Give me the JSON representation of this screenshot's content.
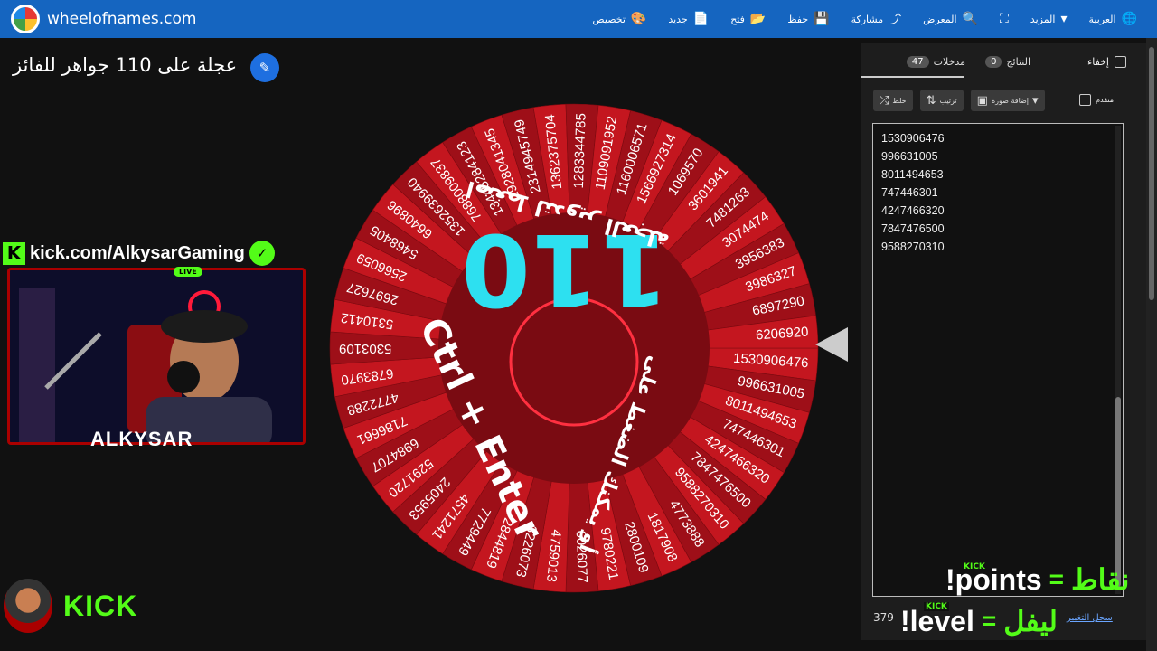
{
  "app": {
    "site": "wheelofnames.com",
    "menu": [
      {
        "name": "menu-language",
        "icon": "globe-icon",
        "glyph": "🌐",
        "label": "العربية"
      },
      {
        "name": "menu-more",
        "icon": "caret-down-icon",
        "glyph": "▾",
        "label": "المزيد"
      },
      {
        "name": "menu-fullscreen",
        "icon": "fullscreen-icon",
        "glyph": "⛶",
        "label": ""
      },
      {
        "name": "menu-gallery",
        "icon": "search-icon",
        "glyph": "🔍",
        "label": "المعرض"
      },
      {
        "name": "menu-share",
        "icon": "share-icon",
        "glyph": "⤴",
        "label": "مشاركة"
      },
      {
        "name": "menu-save",
        "icon": "save-icon",
        "glyph": "💾",
        "label": "حفظ"
      },
      {
        "name": "menu-open",
        "icon": "folder-icon",
        "glyph": "📂",
        "label": "فتح"
      },
      {
        "name": "menu-new",
        "icon": "file-icon",
        "glyph": "📄",
        "label": "جديد"
      },
      {
        "name": "menu-customize",
        "icon": "palette-icon",
        "glyph": "🎨",
        "label": "تخصيص"
      }
    ],
    "colors": {
      "topbar": "#1565c0",
      "kick_green": "#53fc18",
      "wheel_red": "#b3121c"
    }
  },
  "wheel": {
    "title": "عجلة على 110 جواهر للفائز",
    "center_text": "110",
    "hint_top": "اضغط لتدوير العجلة",
    "hint_bottom": "أو يمكنك الضغط على",
    "hint_keys": "Ctrl + Enter",
    "segments": [
      "1530906476",
      "996631005",
      "8011494653",
      "747446301",
      "4247466320",
      "7847476500",
      "9588270310",
      "4773888",
      "1817908",
      "2800109",
      "9780221",
      "6026077",
      "4759013",
      "3226073",
      "2844819",
      "7729449",
      "4571241",
      "2405953",
      "5291720",
      "6984707",
      "7186661",
      "4772288",
      "6783970",
      "5303109",
      "5310412",
      "2697627",
      "2566059",
      "5468405",
      "6640896",
      "1352639940",
      "7688009837",
      "13445284123",
      "2928041345",
      "2314945749",
      "1362375704",
      "1283344785",
      "1109091952",
      "1160006571",
      "1566927314",
      "1069570",
      "3601941",
      "7481263",
      "3074474",
      "3956383",
      "3986327",
      "6897290",
      "6206920"
    ]
  },
  "stream": {
    "kick_url": "kick.com/AlkysarGaming",
    "live": "LIVE",
    "cam_name": "ALKYSAR",
    "kick_logo": "KICK",
    "kick_mini": "KICK",
    "cmd1_ar": "نقاط",
    "cmd1_en": "!points",
    "cmd2_ar": "ليفل",
    "cmd2_en": "!level",
    "eq": "="
  },
  "panel": {
    "hide_label": "إخفاء",
    "results_label": "النتائج",
    "results_count": "0",
    "entries_label": "مدخلات",
    "entries_count": "47",
    "shuffle_label": "خلط",
    "sort_label": "ترتيب",
    "add_image_label": "إضافة صورة",
    "advanced_label": "متقدم",
    "entries": [
      "1530906476",
      "996631005",
      "8011494653",
      "747446301",
      "4247466320",
      "7847476500",
      "9588270310"
    ],
    "footer_count": "379",
    "footer_link": "سجل التغيير"
  }
}
